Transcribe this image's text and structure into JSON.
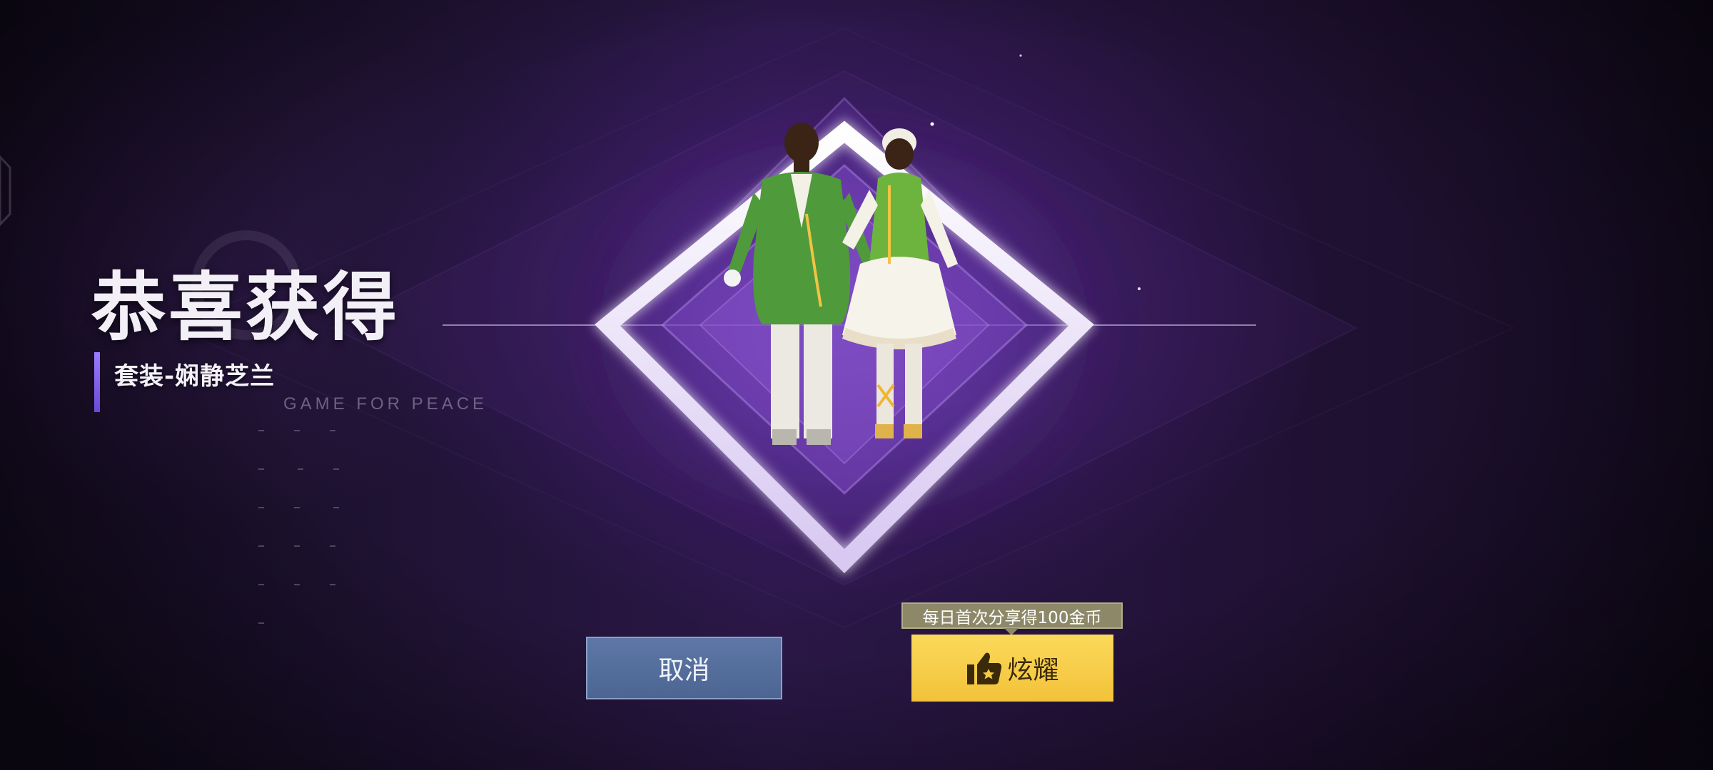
{
  "reward": {
    "title": "恭喜获得",
    "item_name": "套装-娴静芝兰",
    "brand_text": "GAME FOR PEACE"
  },
  "actions": {
    "cancel_label": "取消",
    "share_label": "炫耀",
    "share_tip": "每日首次分享得100金币"
  },
  "icons": {
    "share": "thumbs-up-star-icon",
    "reward": "outfit-pair-figure"
  },
  "colors": {
    "accent_purple": "#8f6df0",
    "cancel_button": "#56709e",
    "share_button": "#f6c940",
    "tooltip_bg": "#8c8868"
  }
}
